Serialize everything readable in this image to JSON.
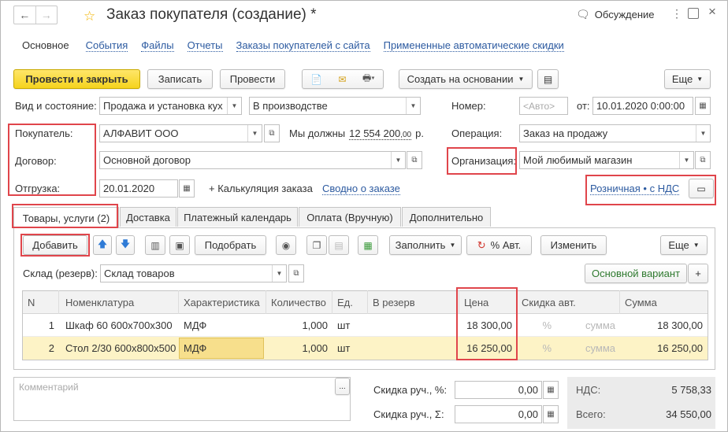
{
  "window": {
    "title": "Заказ покупателя (создание) *",
    "discussion": "Обсуждение",
    "nav_back": "←",
    "nav_forward": "→"
  },
  "sections": [
    "Основное",
    "События",
    "Файлы",
    "Отчеты",
    "Заказы покупателей с сайта",
    "Примененные автоматические скидки"
  ],
  "toolbar": {
    "post_close": "Провести и закрыть",
    "save": "Записать",
    "post": "Провести",
    "create_based": "Создать на основании",
    "more": "Еще"
  },
  "form": {
    "kind_label": "Вид и состояние:",
    "kind_value": "Продажа и установка кух",
    "state_value": "В производстве",
    "number_label": "Номер:",
    "number_placeholder": "<Авто>",
    "date_label": "от:",
    "date_value": "10.01.2020  0:00:00",
    "customer_label": "Покупатель:",
    "customer_value": "АЛФАВИТ ООО",
    "debt_text": "Мы должны",
    "debt_int": "12 554 200",
    "debt_frac": ",00",
    "debt_cur": "р.",
    "operation_label": "Операция:",
    "operation_value": "Заказ на продажу",
    "contract_label": "Договор:",
    "contract_value": "Основной договор",
    "org_label": "Организация:",
    "org_value": "Мой любимый магазин",
    "shipment_label": "Отгрузка:",
    "shipment_value": "20.01.2020",
    "calc_link": "+ Калькуляция заказа",
    "summary_link": "Сводно о заказе",
    "price_type_link": "Розничная • с НДС"
  },
  "tabs": [
    "Товары, услуги (2)",
    "Доставка",
    "Платежный календарь",
    "Оплата (Вручную)",
    "Дополнительно"
  ],
  "goods_toolbar": {
    "add": "Добавить",
    "select": "Подобрать",
    "fill": "Заполнить",
    "auto_disc": "% Авт.",
    "change": "Изменить",
    "more": "Еще"
  },
  "warehouse": {
    "label": "Склад (резерв):",
    "value": "Склад товаров",
    "variant": "Основной вариант",
    "plus": "+"
  },
  "table": {
    "columns": [
      "N",
      "Номенклатура",
      "Характеристика",
      "Количество",
      "Ед.",
      "В резерв",
      "Цена",
      "Скидка авт.",
      "Сумма"
    ],
    "rows": [
      {
        "n": "1",
        "item": "Шкаф 60 600х700х300",
        "char": "МДФ",
        "qty": "1,000",
        "unit": "шт",
        "reserve": "",
        "price": "18 300,00",
        "disc_pct": "%",
        "disc_sum": "сумма",
        "sum": "18 300,00"
      },
      {
        "n": "2",
        "item": "Стол 2/30 600х800х500",
        "char": "МДФ",
        "qty": "1,000",
        "unit": "шт",
        "reserve": "",
        "price": "16 250,00",
        "disc_pct": "%",
        "disc_sum": "сумма",
        "sum": "16 250,00"
      }
    ]
  },
  "footer": {
    "comment_placeholder": "Комментарий",
    "manual_disc_pct_label": "Скидка руч., %:",
    "manual_disc_pct": "0,00",
    "manual_disc_sum_label": "Скидка руч., Σ:",
    "manual_disc_sum": "0,00",
    "vat_label": "НДС:",
    "vat_value": "5 758,33",
    "total_label": "Всего:",
    "total_value": "34 550,00"
  },
  "colors": {
    "accent": "#f5d31d",
    "link": "#2c5aa0",
    "highlight": "#e0454b",
    "selected_row": "#fdf3c6"
  }
}
